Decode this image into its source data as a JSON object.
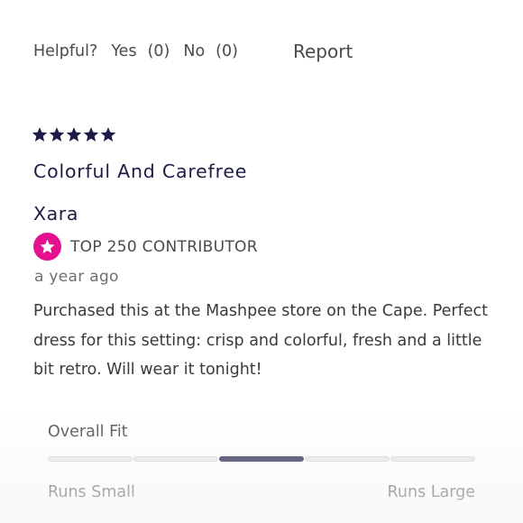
{
  "helpful": {
    "label": "Helpful?",
    "yes_label": "Yes",
    "yes_count": "(0)",
    "no_label": "No",
    "no_count": "(0)",
    "report_label": "Report"
  },
  "review": {
    "rating": 5,
    "rating_max": 5,
    "title": "Colorful And Carefree",
    "author": "Xara",
    "badge": "TOP 250 CONTRIBUTOR",
    "timestamp": "a year ago",
    "body": "Purchased this at the Mashpee store on the Cape. Perfect dress for this setting: crisp and colorful, fresh and a little bit retro. Will wear it tonight!"
  },
  "fit": {
    "label": "Overall Fit",
    "min_label": "Runs Small",
    "max_label": "Runs Large",
    "segments": 5,
    "selected_segment": 3
  },
  "colors": {
    "accent": "#1c1c47",
    "badge": "#e5108f",
    "bar_inactive": "#e6e6e6"
  },
  "icons": {
    "star": "star-icon",
    "badge": "contributor-star-icon"
  }
}
